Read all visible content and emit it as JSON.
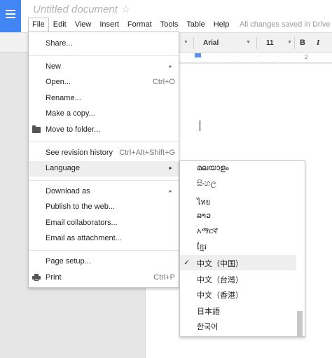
{
  "header": {
    "doc_title": "Untitled document",
    "star_glyph": "☆",
    "save_status": "All changes saved in Drive"
  },
  "menubar": {
    "items": [
      "File",
      "Edit",
      "View",
      "Insert",
      "Format",
      "Tools",
      "Table",
      "Help"
    ],
    "active": "File"
  },
  "toolbar": {
    "font": "Arial",
    "font_size": "11",
    "bold": "B",
    "italic": "I",
    "ruler_number": "2"
  },
  "file_menu": {
    "share": "Share...",
    "new": "New",
    "open": "Open...",
    "open_shortcut": "Ctrl+O",
    "rename": "Rename...",
    "make_copy": "Make a copy...",
    "move_to_folder": "Move to folder...",
    "revision_history": "See revision history",
    "revision_shortcut": "Ctrl+Alt+Shift+G",
    "language": "Language",
    "download_as": "Download as",
    "publish": "Publish to the web...",
    "email_collaborators": "Email collaborators...",
    "email_attachment": "Email as attachment...",
    "page_setup": "Page setup...",
    "print": "Print",
    "print_shortcut": "Ctrl+P",
    "submenu_arrow": "►"
  },
  "language_menu": {
    "items": [
      "മലയാളം",
      "සිංහල",
      "ไทย",
      "ລາວ",
      "አማርኛ",
      "ខ្មែរ",
      "中文（中国）",
      "中文（台灣）",
      "中文（香港）",
      "日本語",
      "한국어"
    ],
    "selected_index": 6,
    "check_glyph": "✓"
  },
  "colors": {
    "brand": "#4285f4",
    "menu_hover": "#eeeeee"
  }
}
